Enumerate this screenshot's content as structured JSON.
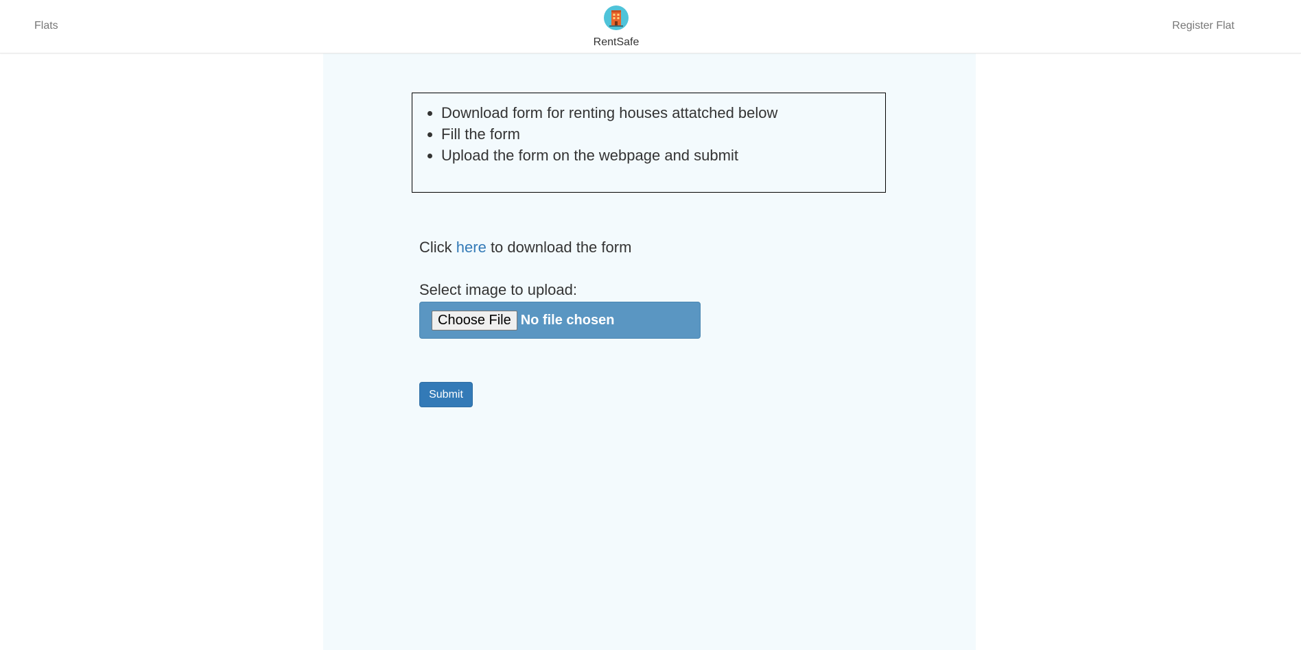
{
  "navbar": {
    "left_link": "Flats",
    "brand_name": "RentSafe",
    "right_link": "Register Flat",
    "logo_icon": "apartment-building-icon"
  },
  "instructions": {
    "items": [
      "Download form for renting houses attatched below",
      "Fill the form",
      "Upload the form on the webpage and submit"
    ]
  },
  "download": {
    "prefix": "Click ",
    "link_text": "here",
    "suffix": " to download the form"
  },
  "upload": {
    "label": "Select image to upload:",
    "button_label": "Choose File",
    "status": "No file chosen"
  },
  "form": {
    "submit_label": "Submit"
  },
  "colors": {
    "panel_bg": "#f3fafd",
    "primary": "#337ab7",
    "file_input_bg": "#5a96c2",
    "logo_circle": "#4fc3d9"
  }
}
